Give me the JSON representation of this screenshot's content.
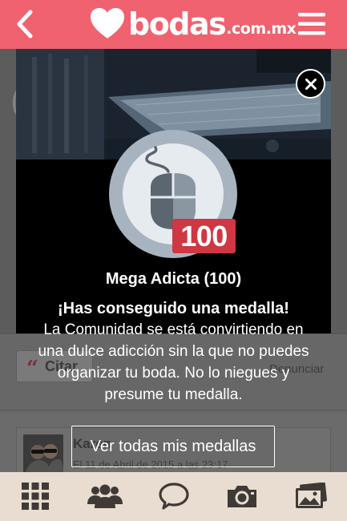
{
  "header": {
    "brand": "bodas",
    "brand_tld": ".com.mx",
    "back_icon": "chevron-left-icon",
    "menu_icon": "hamburger-menu-icon",
    "color": "#f0626f"
  },
  "background": {
    "quote_button_label": "Citar",
    "report_link": "Denunciar",
    "comment": {
      "author": "Karen",
      "date": "El 11 de Abril de 2015 a las 23:17"
    }
  },
  "modal": {
    "close_icon": "close-icon",
    "medal_icon": "computer-mouse-icon",
    "badge_value": "100",
    "title": "Mega Adicta (100)",
    "headline": "¡Has conseguido una medalla!",
    "description": "La Comunidad se está convirtiendo en una dulce adicción sin la que no puedes organizar tu boda. No lo niegues y presume tu medalla.",
    "button_label": "Ver todas mis medallas",
    "badge_color": "#cf3743"
  },
  "tabbar": {
    "color": "#e8ddd0",
    "items": [
      {
        "icon": "grid-icon"
      },
      {
        "icon": "community-icon"
      },
      {
        "icon": "chat-bubble-icon"
      },
      {
        "icon": "camera-icon"
      },
      {
        "icon": "photos-icon"
      }
    ]
  }
}
